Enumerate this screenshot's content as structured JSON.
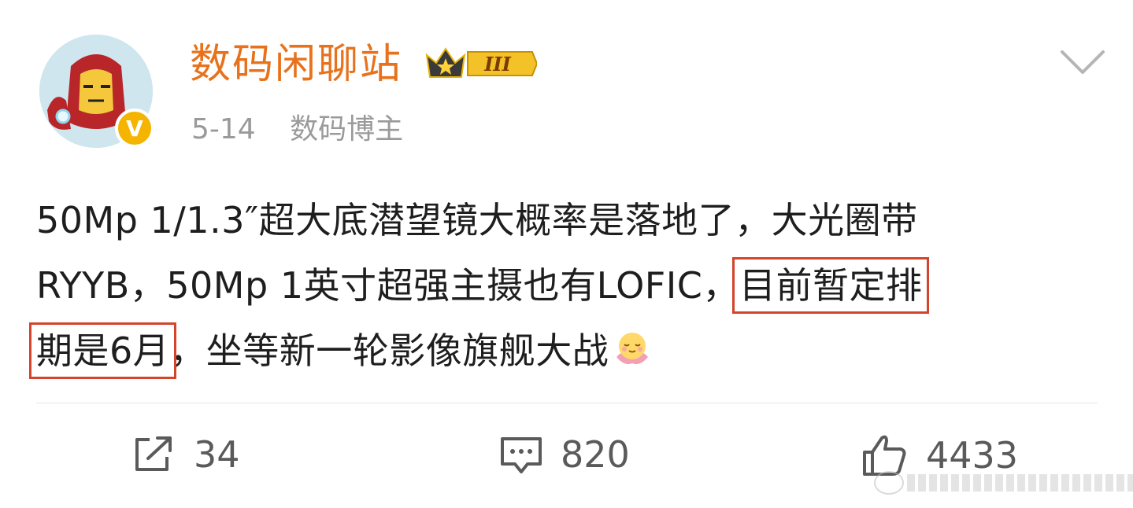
{
  "author": {
    "name": "数码闲聊站",
    "verified_badge": "V",
    "rank_badge": "III",
    "date": "5-14",
    "title": "数码博主"
  },
  "post": {
    "line1": "50Mp 1/1.3″超大底潜望镜大概率是落地了，大光圈带",
    "line2_a": "RYYB，50Mp 1英寸超强主摄也有LOFIC，",
    "line2_hl": "目前暂定排",
    "line3_hl": "期是6月",
    "line3_b": "，坐等新一轮影像旗舰大战",
    "emoji": "lotus-smile-emoji"
  },
  "actions": {
    "repost": "34",
    "comment": "820",
    "like": "4433"
  },
  "colors": {
    "username": "#e8721c",
    "highlight_box": "#d3442b",
    "meta": "#9a9a9a",
    "verified": "#f5b400"
  }
}
